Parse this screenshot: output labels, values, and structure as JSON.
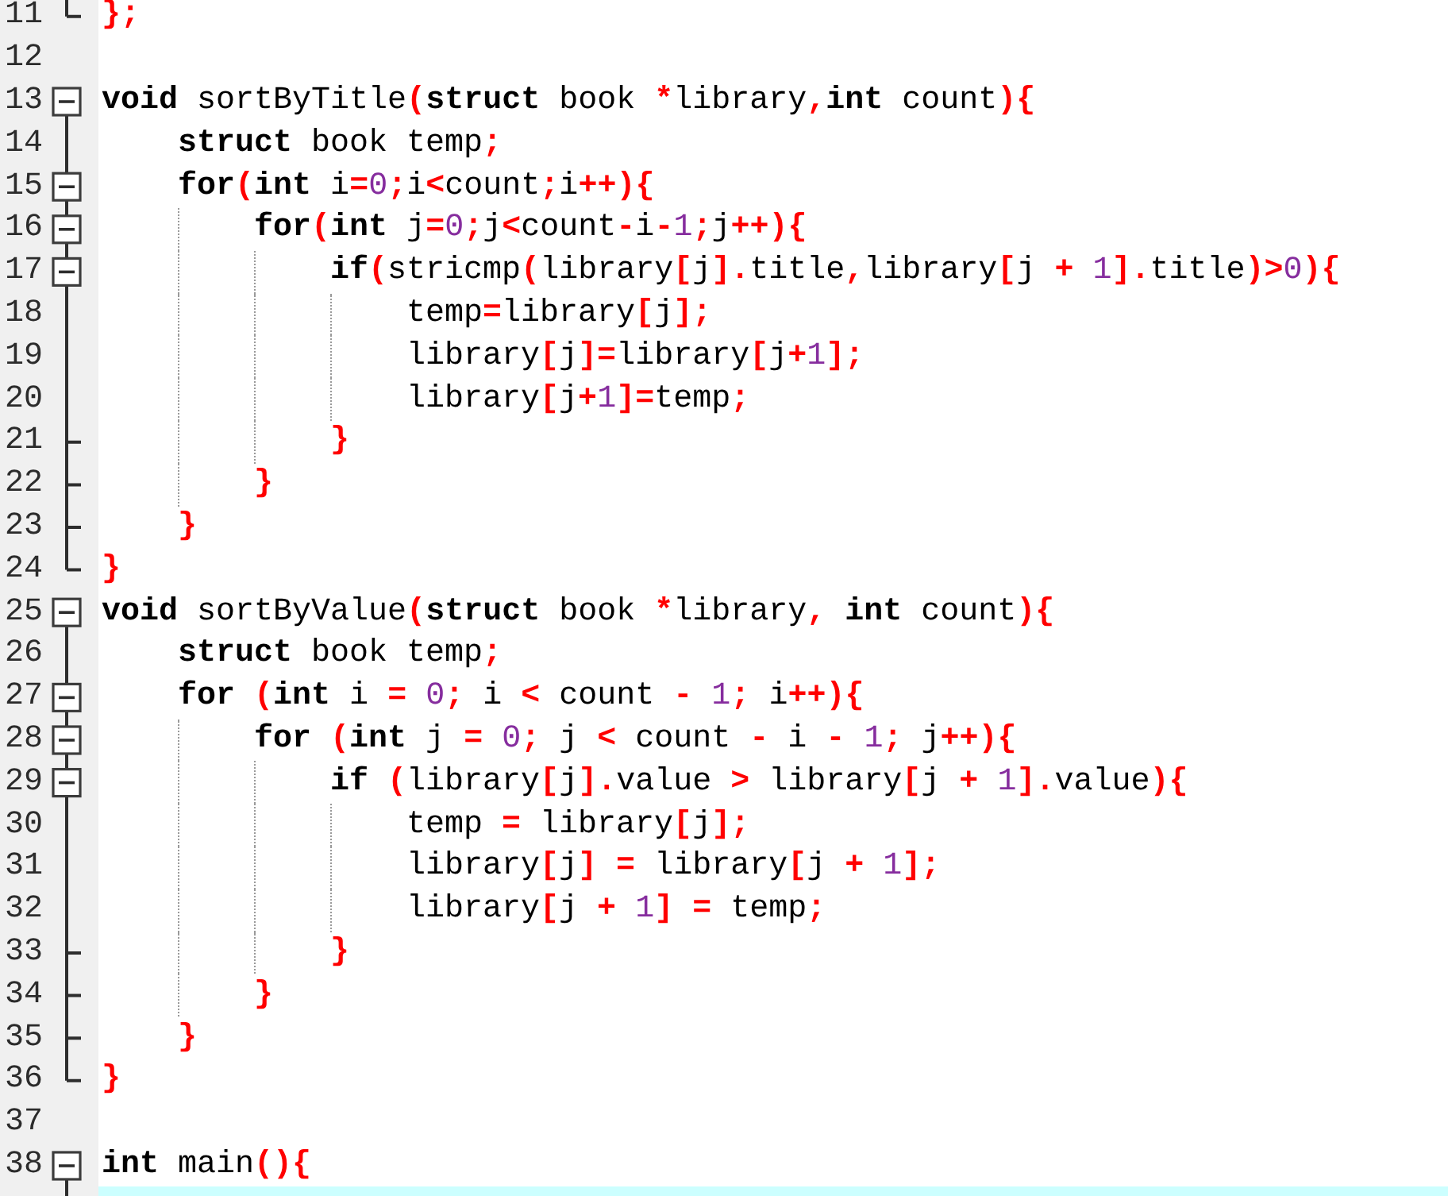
{
  "editor": {
    "lines": [
      {
        "number": "11",
        "current": false,
        "fold_marker": {
          "kind": "end"
        },
        "tokens": [
          {
            "kind": "symbol",
            "text": "};"
          }
        ]
      },
      {
        "number": "12",
        "current": false
      },
      {
        "number": "13",
        "current": false,
        "fold_marker": {
          "kind": "toggle",
          "expanded": true
        },
        "tokens": [
          {
            "kind": "keyword",
            "text": "void"
          },
          {
            "kind": "plain",
            "text": " sortByTitle"
          },
          {
            "kind": "symbol",
            "text": "("
          },
          {
            "kind": "keyword",
            "text": "struct"
          },
          {
            "kind": "plain",
            "text": " book "
          },
          {
            "kind": "symbol",
            "text": "*"
          },
          {
            "kind": "plain",
            "text": "library"
          },
          {
            "kind": "symbol",
            "text": ","
          },
          {
            "kind": "keyword",
            "text": "int"
          },
          {
            "kind": "plain",
            "text": " count"
          },
          {
            "kind": "symbol",
            "text": "){"
          }
        ],
        "children": [
          {
            "number": "14",
            "current": false,
            "fold_marker": {
              "kind": "line"
            },
            "tokens": [
              {
                "kind": "keyword",
                "text": "struct"
              },
              {
                "kind": "plain",
                "text": " book temp"
              },
              {
                "kind": "symbol",
                "text": ";"
              }
            ]
          },
          {
            "number": "15",
            "current": false,
            "fold_marker": {
              "kind": "toggle",
              "expanded": true
            },
            "tokens": [
              {
                "kind": "keyword",
                "text": "for"
              },
              {
                "kind": "symbol",
                "text": "("
              },
              {
                "kind": "keyword",
                "text": "int"
              },
              {
                "kind": "plain",
                "text": " i"
              },
              {
                "kind": "symbol",
                "text": "="
              },
              {
                "kind": "number",
                "text": "0"
              },
              {
                "kind": "symbol",
                "text": ";"
              },
              {
                "kind": "plain",
                "text": "i"
              },
              {
                "kind": "symbol",
                "text": "<"
              },
              {
                "kind": "plain",
                "text": "count"
              },
              {
                "kind": "symbol",
                "text": ";"
              },
              {
                "kind": "plain",
                "text": "i"
              },
              {
                "kind": "symbol",
                "text": "++){"
              }
            ],
            "children": [
              {
                "number": "16",
                "current": false,
                "fold_marker": {
                  "kind": "toggle",
                  "expanded": true
                },
                "tokens": [
                  {
                    "kind": "keyword",
                    "text": "for"
                  },
                  {
                    "kind": "symbol",
                    "text": "("
                  },
                  {
                    "kind": "keyword",
                    "text": "int"
                  },
                  {
                    "kind": "plain",
                    "text": " j"
                  },
                  {
                    "kind": "symbol",
                    "text": "="
                  },
                  {
                    "kind": "number",
                    "text": "0"
                  },
                  {
                    "kind": "symbol",
                    "text": ";"
                  },
                  {
                    "kind": "plain",
                    "text": "j"
                  },
                  {
                    "kind": "symbol",
                    "text": "<"
                  },
                  {
                    "kind": "plain",
                    "text": "count"
                  },
                  {
                    "kind": "symbol",
                    "text": "-"
                  },
                  {
                    "kind": "plain",
                    "text": "i"
                  },
                  {
                    "kind": "symbol",
                    "text": "-"
                  },
                  {
                    "kind": "number",
                    "text": "1"
                  },
                  {
                    "kind": "symbol",
                    "text": ";"
                  },
                  {
                    "kind": "plain",
                    "text": "j"
                  },
                  {
                    "kind": "symbol",
                    "text": "++){"
                  }
                ],
                "children": [
                  {
                    "number": "17",
                    "current": false,
                    "fold_marker": {
                      "kind": "toggle",
                      "expanded": true
                    },
                    "tokens": [
                      {
                        "kind": "keyword",
                        "text": "if"
                      },
                      {
                        "kind": "symbol",
                        "text": "("
                      },
                      {
                        "kind": "plain",
                        "text": "stricmp"
                      },
                      {
                        "kind": "symbol",
                        "text": "("
                      },
                      {
                        "kind": "plain",
                        "text": "library"
                      },
                      {
                        "kind": "symbol",
                        "text": "["
                      },
                      {
                        "kind": "plain",
                        "text": "j"
                      },
                      {
                        "kind": "symbol",
                        "text": "]."
                      },
                      {
                        "kind": "plain",
                        "text": "title"
                      },
                      {
                        "kind": "symbol",
                        "text": ","
                      },
                      {
                        "kind": "plain",
                        "text": "library"
                      },
                      {
                        "kind": "symbol",
                        "text": "["
                      },
                      {
                        "kind": "plain",
                        "text": "j "
                      },
                      {
                        "kind": "symbol",
                        "text": "+ "
                      },
                      {
                        "kind": "number",
                        "text": "1"
                      },
                      {
                        "kind": "symbol",
                        "text": "]."
                      },
                      {
                        "kind": "plain",
                        "text": "title"
                      },
                      {
                        "kind": "symbol",
                        "text": ")>"
                      },
                      {
                        "kind": "number",
                        "text": "0"
                      },
                      {
                        "kind": "symbol",
                        "text": "){"
                      }
                    ],
                    "children": [
                      {
                        "number": "18",
                        "current": false,
                        "fold_marker": {
                          "kind": "line"
                        },
                        "tokens": [
                          {
                            "kind": "plain",
                            "text": "temp"
                          },
                          {
                            "kind": "symbol",
                            "text": "="
                          },
                          {
                            "kind": "plain",
                            "text": "library"
                          },
                          {
                            "kind": "symbol",
                            "text": "["
                          },
                          {
                            "kind": "plain",
                            "text": "j"
                          },
                          {
                            "kind": "symbol",
                            "text": "];"
                          }
                        ]
                      },
                      {
                        "number": "19",
                        "current": false,
                        "fold_marker": {
                          "kind": "line"
                        },
                        "tokens": [
                          {
                            "kind": "plain",
                            "text": "library"
                          },
                          {
                            "kind": "symbol",
                            "text": "["
                          },
                          {
                            "kind": "plain",
                            "text": "j"
                          },
                          {
                            "kind": "symbol",
                            "text": "]="
                          },
                          {
                            "kind": "plain",
                            "text": "library"
                          },
                          {
                            "kind": "symbol",
                            "text": "["
                          },
                          {
                            "kind": "plain",
                            "text": "j"
                          },
                          {
                            "kind": "symbol",
                            "text": "+"
                          },
                          {
                            "kind": "number",
                            "text": "1"
                          },
                          {
                            "kind": "symbol",
                            "text": "];"
                          }
                        ]
                      },
                      {
                        "number": "20",
                        "current": false,
                        "fold_marker": {
                          "kind": "line"
                        },
                        "tokens": [
                          {
                            "kind": "plain",
                            "text": "library"
                          },
                          {
                            "kind": "symbol",
                            "text": "["
                          },
                          {
                            "kind": "plain",
                            "text": "j"
                          },
                          {
                            "kind": "symbol",
                            "text": "+"
                          },
                          {
                            "kind": "number",
                            "text": "1"
                          },
                          {
                            "kind": "symbol",
                            "text": "]="
                          },
                          {
                            "kind": "plain",
                            "text": "temp"
                          },
                          {
                            "kind": "symbol",
                            "text": ";"
                          }
                        ]
                      }
                    ]
                  },
                  {
                    "number": "21",
                    "current": false,
                    "fold_marker": {
                      "kind": "branch_end"
                    },
                    "tokens": [
                      {
                        "kind": "symbol",
                        "text": "}"
                      }
                    ]
                  }
                ]
              },
              {
                "number": "22",
                "current": false,
                "fold_marker": {
                  "kind": "branch_end"
                },
                "tokens": [
                  {
                    "kind": "symbol",
                    "text": "}"
                  }
                ]
              }
            ]
          },
          {
            "number": "23",
            "current": false,
            "fold_marker": {
              "kind": "branch_end"
            },
            "tokens": [
              {
                "kind": "symbol",
                "text": "}"
              }
            ]
          }
        ]
      },
      {
        "number": "24",
        "current": false,
        "fold_marker": {
          "kind": "end"
        },
        "tokens": [
          {
            "kind": "symbol",
            "text": "}"
          }
        ]
      },
      {
        "number": "25",
        "current": false,
        "fold_marker": {
          "kind": "toggle",
          "expanded": true
        },
        "tokens": [
          {
            "kind": "keyword",
            "text": "void"
          },
          {
            "kind": "plain",
            "text": " sortByValue"
          },
          {
            "kind": "symbol",
            "text": "("
          },
          {
            "kind": "keyword",
            "text": "struct"
          },
          {
            "kind": "plain",
            "text": " book "
          },
          {
            "kind": "symbol",
            "text": "*"
          },
          {
            "kind": "plain",
            "text": "library"
          },
          {
            "kind": "symbol",
            "text": ", "
          },
          {
            "kind": "keyword",
            "text": "int"
          },
          {
            "kind": "plain",
            "text": " count"
          },
          {
            "kind": "symbol",
            "text": "){"
          }
        ],
        "children": [
          {
            "number": "26",
            "current": false,
            "fold_marker": {
              "kind": "line"
            },
            "tokens": [
              {
                "kind": "keyword",
                "text": "struct"
              },
              {
                "kind": "plain",
                "text": " book temp"
              },
              {
                "kind": "symbol",
                "text": ";"
              }
            ]
          },
          {
            "number": "27",
            "current": false,
            "fold_marker": {
              "kind": "toggle",
              "expanded": true
            },
            "tokens": [
              {
                "kind": "keyword",
                "text": "for "
              },
              {
                "kind": "symbol",
                "text": "("
              },
              {
                "kind": "keyword",
                "text": "int"
              },
              {
                "kind": "plain",
                "text": " i "
              },
              {
                "kind": "symbol",
                "text": "= "
              },
              {
                "kind": "number",
                "text": "0"
              },
              {
                "kind": "symbol",
                "text": ";"
              },
              {
                "kind": "plain",
                "text": " i "
              },
              {
                "kind": "symbol",
                "text": "<"
              },
              {
                "kind": "plain",
                "text": " count "
              },
              {
                "kind": "symbol",
                "text": "- "
              },
              {
                "kind": "number",
                "text": "1"
              },
              {
                "kind": "symbol",
                "text": ";"
              },
              {
                "kind": "plain",
                "text": " i"
              },
              {
                "kind": "symbol",
                "text": "++){"
              }
            ],
            "children": [
              {
                "number": "28",
                "current": false,
                "fold_marker": {
                  "kind": "toggle",
                  "expanded": true
                },
                "tokens": [
                  {
                    "kind": "keyword",
                    "text": "for "
                  },
                  {
                    "kind": "symbol",
                    "text": "("
                  },
                  {
                    "kind": "keyword",
                    "text": "int"
                  },
                  {
                    "kind": "plain",
                    "text": " j "
                  },
                  {
                    "kind": "symbol",
                    "text": "= "
                  },
                  {
                    "kind": "number",
                    "text": "0"
                  },
                  {
                    "kind": "symbol",
                    "text": ";"
                  },
                  {
                    "kind": "plain",
                    "text": " j "
                  },
                  {
                    "kind": "symbol",
                    "text": "<"
                  },
                  {
                    "kind": "plain",
                    "text": " count "
                  },
                  {
                    "kind": "symbol",
                    "text": "-"
                  },
                  {
                    "kind": "plain",
                    "text": " i "
                  },
                  {
                    "kind": "symbol",
                    "text": "- "
                  },
                  {
                    "kind": "number",
                    "text": "1"
                  },
                  {
                    "kind": "symbol",
                    "text": ";"
                  },
                  {
                    "kind": "plain",
                    "text": " j"
                  },
                  {
                    "kind": "symbol",
                    "text": "++){"
                  }
                ],
                "children": [
                  {
                    "number": "29",
                    "current": false,
                    "fold_marker": {
                      "kind": "toggle",
                      "expanded": true
                    },
                    "tokens": [
                      {
                        "kind": "keyword",
                        "text": "if "
                      },
                      {
                        "kind": "symbol",
                        "text": "("
                      },
                      {
                        "kind": "plain",
                        "text": "library"
                      },
                      {
                        "kind": "symbol",
                        "text": "["
                      },
                      {
                        "kind": "plain",
                        "text": "j"
                      },
                      {
                        "kind": "symbol",
                        "text": "]."
                      },
                      {
                        "kind": "plain",
                        "text": "value "
                      },
                      {
                        "kind": "symbol",
                        "text": ">"
                      },
                      {
                        "kind": "plain",
                        "text": " library"
                      },
                      {
                        "kind": "symbol",
                        "text": "["
                      },
                      {
                        "kind": "plain",
                        "text": "j "
                      },
                      {
                        "kind": "symbol",
                        "text": "+ "
                      },
                      {
                        "kind": "number",
                        "text": "1"
                      },
                      {
                        "kind": "symbol",
                        "text": "]."
                      },
                      {
                        "kind": "plain",
                        "text": "value"
                      },
                      {
                        "kind": "symbol",
                        "text": "){"
                      }
                    ],
                    "children": [
                      {
                        "number": "30",
                        "current": false,
                        "fold_marker": {
                          "kind": "line"
                        },
                        "tokens": [
                          {
                            "kind": "plain",
                            "text": "temp "
                          },
                          {
                            "kind": "symbol",
                            "text": "="
                          },
                          {
                            "kind": "plain",
                            "text": " library"
                          },
                          {
                            "kind": "symbol",
                            "text": "["
                          },
                          {
                            "kind": "plain",
                            "text": "j"
                          },
                          {
                            "kind": "symbol",
                            "text": "];"
                          }
                        ]
                      },
                      {
                        "number": "31",
                        "current": false,
                        "fold_marker": {
                          "kind": "line"
                        },
                        "tokens": [
                          {
                            "kind": "plain",
                            "text": "library"
                          },
                          {
                            "kind": "symbol",
                            "text": "["
                          },
                          {
                            "kind": "plain",
                            "text": "j"
                          },
                          {
                            "kind": "symbol",
                            "text": "] ="
                          },
                          {
                            "kind": "plain",
                            "text": " library"
                          },
                          {
                            "kind": "symbol",
                            "text": "["
                          },
                          {
                            "kind": "plain",
                            "text": "j "
                          },
                          {
                            "kind": "symbol",
                            "text": "+ "
                          },
                          {
                            "kind": "number",
                            "text": "1"
                          },
                          {
                            "kind": "symbol",
                            "text": "];"
                          }
                        ]
                      },
                      {
                        "number": "32",
                        "current": false,
                        "fold_marker": {
                          "kind": "line"
                        },
                        "tokens": [
                          {
                            "kind": "plain",
                            "text": "library"
                          },
                          {
                            "kind": "symbol",
                            "text": "["
                          },
                          {
                            "kind": "plain",
                            "text": "j "
                          },
                          {
                            "kind": "symbol",
                            "text": "+ "
                          },
                          {
                            "kind": "number",
                            "text": "1"
                          },
                          {
                            "kind": "symbol",
                            "text": "] ="
                          },
                          {
                            "kind": "plain",
                            "text": " temp"
                          },
                          {
                            "kind": "symbol",
                            "text": ";"
                          }
                        ]
                      }
                    ]
                  },
                  {
                    "number": "33",
                    "current": false,
                    "fold_marker": {
                      "kind": "branch_end"
                    },
                    "tokens": [
                      {
                        "kind": "symbol",
                        "text": "}"
                      }
                    ]
                  }
                ]
              },
              {
                "number": "34",
                "current": false,
                "fold_marker": {
                  "kind": "branch_end"
                },
                "tokens": [
                  {
                    "kind": "symbol",
                    "text": "}"
                  }
                ]
              }
            ]
          },
          {
            "number": "35",
            "current": false,
            "fold_marker": {
              "kind": "branch_end"
            },
            "tokens": [
              {
                "kind": "symbol",
                "text": "}"
              }
            ]
          }
        ]
      },
      {
        "number": "36",
        "current": false,
        "fold_marker": {
          "kind": "end"
        },
        "tokens": [
          {
            "kind": "symbol",
            "text": "}"
          }
        ]
      },
      {
        "number": "37",
        "current": false
      },
      {
        "number": "38",
        "current": false,
        "fold_marker": {
          "kind": "toggle",
          "expanded": true
        },
        "tokens": [
          {
            "kind": "keyword",
            "text": "int"
          },
          {
            "kind": "plain",
            "text": " main"
          },
          {
            "kind": "symbol",
            "text": "(){"
          }
        ],
        "children": [
          {
            "current": true,
            "fold_marker": {
              "kind": "line"
            }
          }
        ]
      }
    ]
  }
}
